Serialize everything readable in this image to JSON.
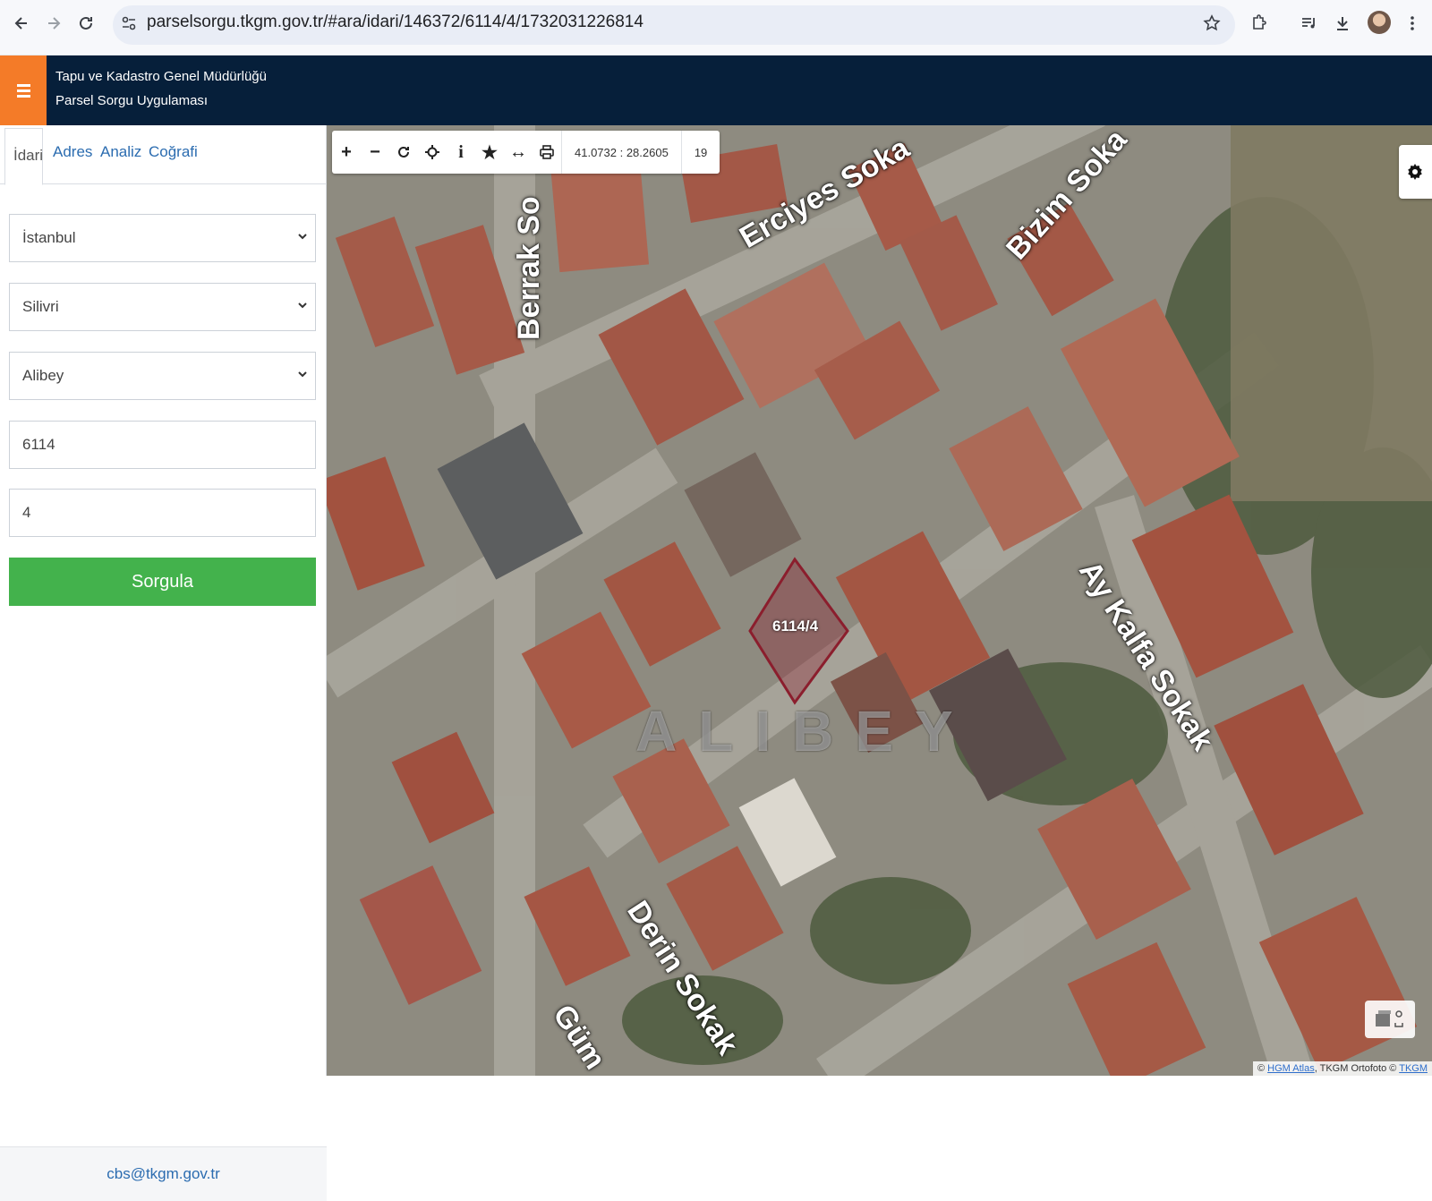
{
  "browser": {
    "url": "parselsorgu.tkgm.gov.tr/#ara/idari/146372/6114/4/1732031226814"
  },
  "header": {
    "org_title": "Tapu ve Kadastro Genel Müdürlüğü",
    "app_title": "Parsel Sorgu Uygulaması"
  },
  "sidebar": {
    "tabs": [
      "İdari",
      "Adres",
      "Analiz",
      "Coğrafi"
    ],
    "province": "İstanbul",
    "district": "Silivri",
    "neighborhood": "Alibey",
    "block": "6114",
    "parcel": "4",
    "query_button": "Sorgula",
    "footer_email": "cbs@tkgm.gov.tr"
  },
  "map": {
    "coordinates": "41.0732 : 28.2605",
    "zoom": "19",
    "parcel_label": "6114/4",
    "neighborhood_label": "ALIBEY",
    "streets": [
      "Erciyes Soka",
      "Bizim Soka",
      "Berrak So",
      "Ay Kalfa Sokak",
      "Derin Sokak",
      "Güm"
    ],
    "attribution_prefix": "© ",
    "attribution_link1": "HGM Atlas",
    "attribution_mid": ", TKGM Ortofoto © ",
    "attribution_link2": "TKGM",
    "parcel_color": "#8b1e2d"
  }
}
